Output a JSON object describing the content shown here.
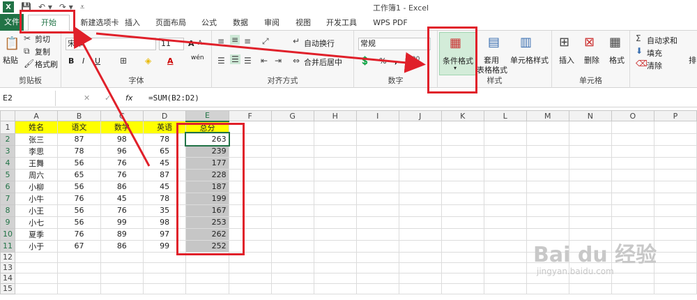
{
  "window": {
    "title": "工作簿1 - Excel"
  },
  "tabs": [
    "文件",
    "开始",
    "新建选项卡",
    "插入",
    "页面布局",
    "公式",
    "数据",
    "审阅",
    "视图",
    "开发工具",
    "WPS PDF"
  ],
  "ribbon": {
    "clipboard": {
      "paste": "粘贴",
      "cut": "剪切",
      "copy": "复制",
      "painter": "格式刷",
      "label": "剪贴板"
    },
    "font": {
      "name": "宋体",
      "size": "11",
      "label": "字体",
      "bold": "B",
      "italic": "I",
      "underline": "U",
      "grow": "A",
      "shrink": "A",
      "phonetic": "wén"
    },
    "align": {
      "wrap": "自动换行",
      "merge": "合并后居中",
      "label": "对齐方式"
    },
    "number": {
      "format": "常规",
      "percent": "%",
      "comma": ",",
      "label": "数字"
    },
    "styles": {
      "cond": "条件格式",
      "table1": "套用",
      "table2": "表格格式",
      "cell": "单元格样式",
      "label": "样式"
    },
    "cells": {
      "insert": "插入",
      "delete": "删除",
      "format": "格式",
      "label": "单元格"
    },
    "edit": {
      "autosum": "自动求和",
      "fill": "填充",
      "clear": "清除",
      "sort": "排"
    }
  },
  "formula_bar": {
    "name_box": "E2",
    "formula": "=SUM(B2:D2)",
    "cancel": "✕",
    "enter": "✓",
    "fx": "fx"
  },
  "sheet": {
    "columns": [
      "A",
      "B",
      "C",
      "D",
      "E",
      "F",
      "G",
      "H",
      "I",
      "J",
      "K",
      "L",
      "M",
      "N",
      "O",
      "P"
    ],
    "rows": [
      [
        "姓名",
        "语文",
        "数学",
        "英语",
        "总分"
      ],
      [
        "张三",
        "87",
        "98",
        "78",
        "263"
      ],
      [
        "李思",
        "78",
        "96",
        "65",
        "239"
      ],
      [
        "王舞",
        "56",
        "76",
        "45",
        "177"
      ],
      [
        "周六",
        "65",
        "76",
        "87",
        "228"
      ],
      [
        "小柳",
        "56",
        "86",
        "45",
        "187"
      ],
      [
        "小牛",
        "76",
        "45",
        "78",
        "199"
      ],
      [
        "小王",
        "56",
        "76",
        "35",
        "167"
      ],
      [
        "小七",
        "56",
        "99",
        "98",
        "253"
      ],
      [
        "夏季",
        "76",
        "89",
        "97",
        "262"
      ],
      [
        "小于",
        "67",
        "86",
        "99",
        "252"
      ]
    ],
    "row_count": 15
  },
  "watermark": {
    "brand": "Bai du 经验",
    "url": "jingyan.baidu.com"
  },
  "colors": {
    "accent": "#217346",
    "highlight": "#ffff00",
    "annotation": "#e0202a"
  }
}
